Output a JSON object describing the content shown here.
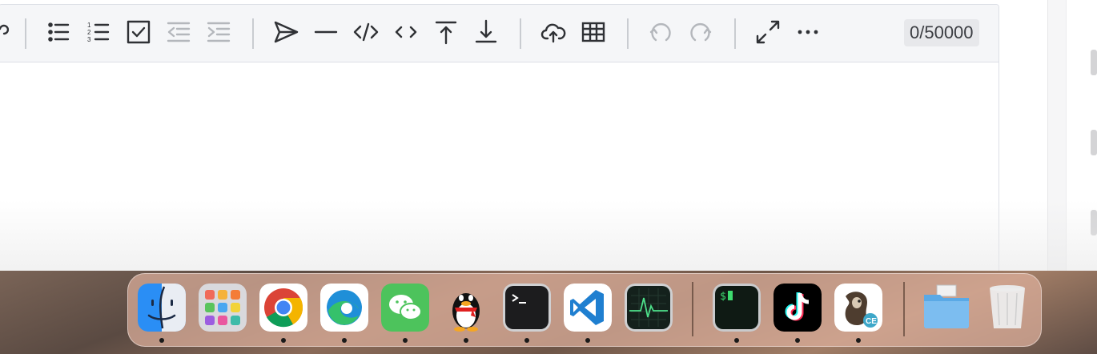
{
  "editor": {
    "char_count": "0/50000"
  },
  "toolbar": {
    "items": [
      {
        "name": "unordered-list",
        "icon": "unordered-list-icon",
        "enabled": true
      },
      {
        "name": "ordered-list",
        "icon": "ordered-list-icon",
        "enabled": true
      },
      {
        "name": "task-list",
        "icon": "checkbox-icon",
        "enabled": true
      },
      {
        "name": "outdent",
        "icon": "outdent-icon",
        "enabled": false
      },
      {
        "name": "indent",
        "icon": "indent-icon",
        "enabled": false
      },
      {
        "name": "quote",
        "icon": "send-icon",
        "enabled": true
      },
      {
        "name": "horizontal-rule",
        "icon": "line-icon",
        "enabled": true
      },
      {
        "name": "code-block",
        "icon": "code-block-icon",
        "enabled": true
      },
      {
        "name": "inline-code",
        "icon": "inline-code-icon",
        "enabled": true
      },
      {
        "name": "insert-before",
        "icon": "arrow-up-bar-icon",
        "enabled": true
      },
      {
        "name": "insert-after",
        "icon": "arrow-down-bar-icon",
        "enabled": true
      },
      {
        "name": "upload",
        "icon": "cloud-upload-icon",
        "enabled": true
      },
      {
        "name": "table",
        "icon": "table-icon",
        "enabled": true
      },
      {
        "name": "undo",
        "icon": "undo-icon",
        "enabled": false
      },
      {
        "name": "redo",
        "icon": "redo-icon",
        "enabled": false
      },
      {
        "name": "fullscreen",
        "icon": "expand-icon",
        "enabled": true
      },
      {
        "name": "more",
        "icon": "more-icon",
        "enabled": true
      }
    ]
  },
  "dock": {
    "apps": [
      {
        "name": "Finder",
        "icon": "finder-icon",
        "running": true
      },
      {
        "name": "Launchpad",
        "icon": "launchpad-icon",
        "running": false
      },
      {
        "name": "Google Chrome",
        "icon": "chrome-icon",
        "running": true
      },
      {
        "name": "Microsoft Edge",
        "icon": "edge-icon",
        "running": true
      },
      {
        "name": "WeChat",
        "icon": "wechat-icon",
        "running": true
      },
      {
        "name": "QQ",
        "icon": "qq-penguin-icon",
        "running": true
      },
      {
        "name": "Terminal",
        "icon": "terminal-icon",
        "running": true
      },
      {
        "name": "Visual Studio Code",
        "icon": "vscode-icon",
        "running": true
      },
      {
        "name": "Activity Monitor",
        "icon": "activity-monitor-icon",
        "running": false
      },
      {
        "name": "iTerm",
        "icon": "iterm-icon",
        "running": true
      },
      {
        "name": "TikTok",
        "icon": "tiktok-icon",
        "running": true
      },
      {
        "name": "DBeaver CE",
        "icon": "dbeaver-icon",
        "running": true
      },
      {
        "name": "Downloads",
        "icon": "folder-icon",
        "running": false
      },
      {
        "name": "Trash",
        "icon": "trash-icon",
        "running": false
      }
    ]
  },
  "colors": {
    "icon": "#2f3135",
    "icon_disabled": "#b4b7bc",
    "toolbar_bg": "#f5f6f8",
    "dock_bg": "#deb09c"
  }
}
